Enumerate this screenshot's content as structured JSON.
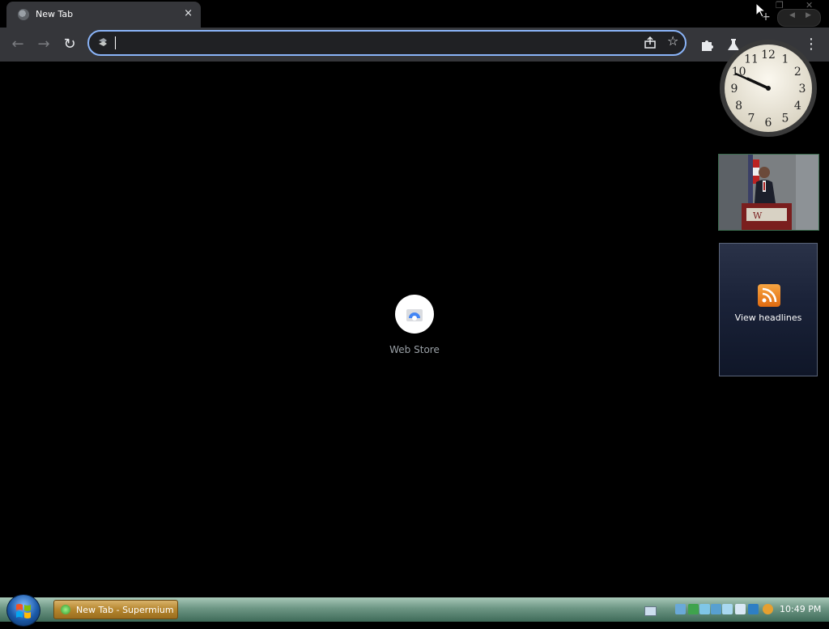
{
  "tab": {
    "title": "New Tab",
    "close_glyph": "×",
    "favicon": "globe-icon"
  },
  "tabstrip": {
    "new_tab_glyph": "+"
  },
  "toolbar": {
    "back_glyph": "←",
    "forward_glyph": "→",
    "reload_glyph": "↻",
    "star_glyph": "☆",
    "menu_glyph": "⋮"
  },
  "omnibox": {
    "value": "",
    "placeholder": ""
  },
  "shortcut": {
    "label": "Web Store"
  },
  "gadgets": {
    "clock": {
      "numerals": [
        "12",
        "1",
        "2",
        "3",
        "4",
        "5",
        "6",
        "7",
        "8",
        "9",
        "10",
        "11"
      ],
      "hour": 9,
      "minute": 49
    },
    "feed": {
      "label": "View headlines"
    }
  },
  "taskbar": {
    "task_label": "New Tab - Supermium",
    "time": "10:49 PM"
  },
  "colors": {
    "accent": "#8ab4f8",
    "tab_bg": "#35363a",
    "omnibox_bg": "#202124",
    "page_bg": "#000000"
  }
}
